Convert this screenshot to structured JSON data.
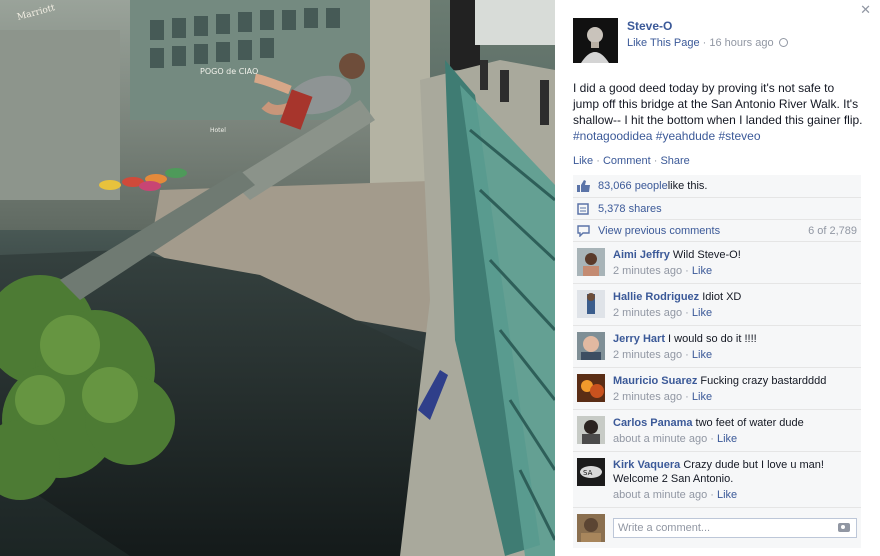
{
  "page": {
    "name": "Steve-O",
    "like_label": "Like This Page",
    "time": "16 hours ago"
  },
  "post": {
    "text": "I did a good deed today by proving it's not safe to jump off this bridge at the San Antonio River Walk. It's shallow-- I hit the bottom when I landed this gainer flip. ",
    "tags": [
      "#notagoodidea",
      "#yeahdude",
      "#steveo"
    ]
  },
  "actions": {
    "like": "Like",
    "comment": "Comment",
    "share": "Share"
  },
  "stats": {
    "likes_count": "83,066 people",
    "likes_suffix": " like this.",
    "shares": "5,378 shares",
    "view_previous": "View previous comments",
    "comment_range": "6 of 2,789"
  },
  "comments": [
    {
      "name": "Aimi Jeffry",
      "text": "Wild Steve-O!",
      "time": "2 minutes ago",
      "like": "Like"
    },
    {
      "name": "Hallie Rodriguez",
      "text": "Idiot XD",
      "time": "2 minutes ago",
      "like": "Like"
    },
    {
      "name": "Jerry Hart",
      "text": "I would so do it !!!!",
      "time": "2 minutes ago",
      "like": "Like"
    },
    {
      "name": "Mauricio Suarez",
      "text": "Fucking crazy bastardddd",
      "time": "2 minutes ago",
      "like": "Like"
    },
    {
      "name": "Carlos Panama",
      "text": "two feet of water dude",
      "time": "about a minute ago",
      "like": "Like"
    },
    {
      "name": "Kirk Vaquera",
      "text": "Crazy dude but I love u man! Welcome 2 San Antonio.",
      "time": "about a minute ago",
      "like": "Like"
    }
  ],
  "composer": {
    "placeholder": "Write a comment..."
  },
  "photo_signs": {
    "pogo": "POGO de CIAO",
    "hotel": "Hotel",
    "marriott": "Marriott"
  },
  "colors": {
    "link": "#3b5998",
    "muted": "#9197a3",
    "ufi_bg": "#f6f7f8"
  },
  "icons": [
    "close-icon",
    "globe-icon",
    "thumbs-up-icon",
    "share-icon",
    "comment-icon",
    "camera-icon"
  ]
}
